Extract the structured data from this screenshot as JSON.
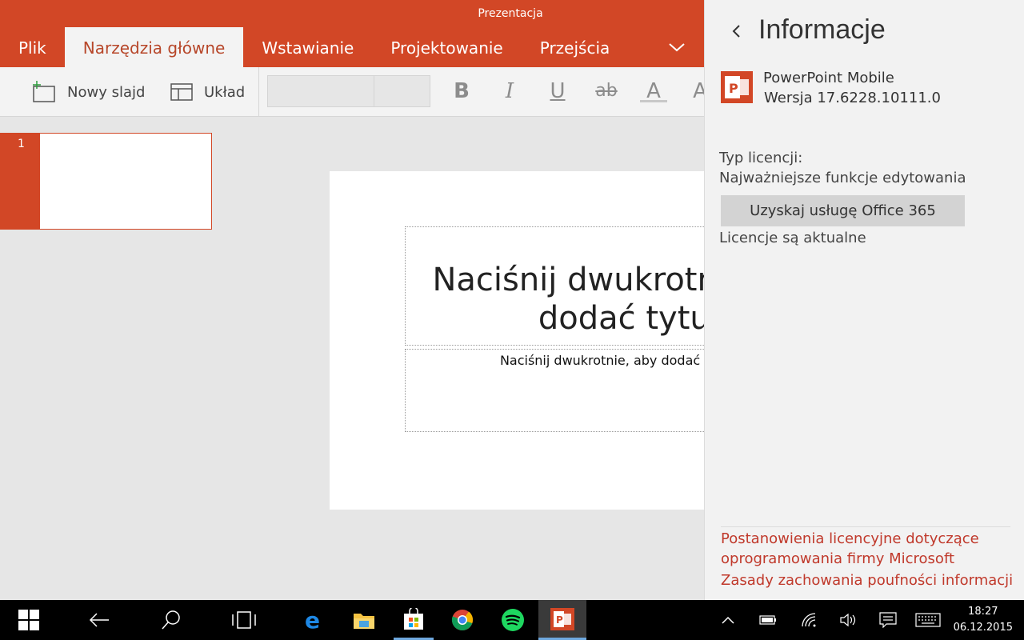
{
  "app": {
    "title": "Prezentacja"
  },
  "ribbon": {
    "tabs": [
      "Plik",
      "Narzędzia główne",
      "Wstawianie",
      "Projektowanie",
      "Przejścia"
    ],
    "new_slide_label": "Nowy slajd",
    "layout_label": "Układ",
    "format": {
      "bold": "B",
      "italic": "I",
      "underline": "U",
      "strike": "ab",
      "font_color": "A",
      "highlight": "A"
    }
  },
  "slides_panel": {
    "slide_number": "1"
  },
  "slide": {
    "title_line1": "Naciśnij dwukrotnie, aby",
    "title_line2": "dodać tytuł",
    "subtitle": "Naciśnij dwukrotnie, aby dodać podtytuł"
  },
  "info_pane": {
    "title": "Informacje",
    "product_name": "PowerPoint Mobile",
    "version": "Wersja 17.6228.10111.0",
    "license_label": "Typ licencji:",
    "license_type": "Najważniejsze funkcje edytowania",
    "get_office_button": "Uzyskaj usługę Office 365",
    "license_status": "Licencje są aktualne",
    "links": {
      "terms_line1": "Postanowienia licencyjne dotyczące",
      "terms_line2": "oprogramowania firmy Microsoft",
      "privacy": "Zasady zachowania poufności informacji"
    }
  },
  "taskbar": {
    "time": "18:27",
    "date": "06.12.2015"
  },
  "colors": {
    "accent": "#d24726",
    "link": "#c0392b",
    "pane_bg": "#f2f2f2",
    "taskbar": "#000000"
  }
}
